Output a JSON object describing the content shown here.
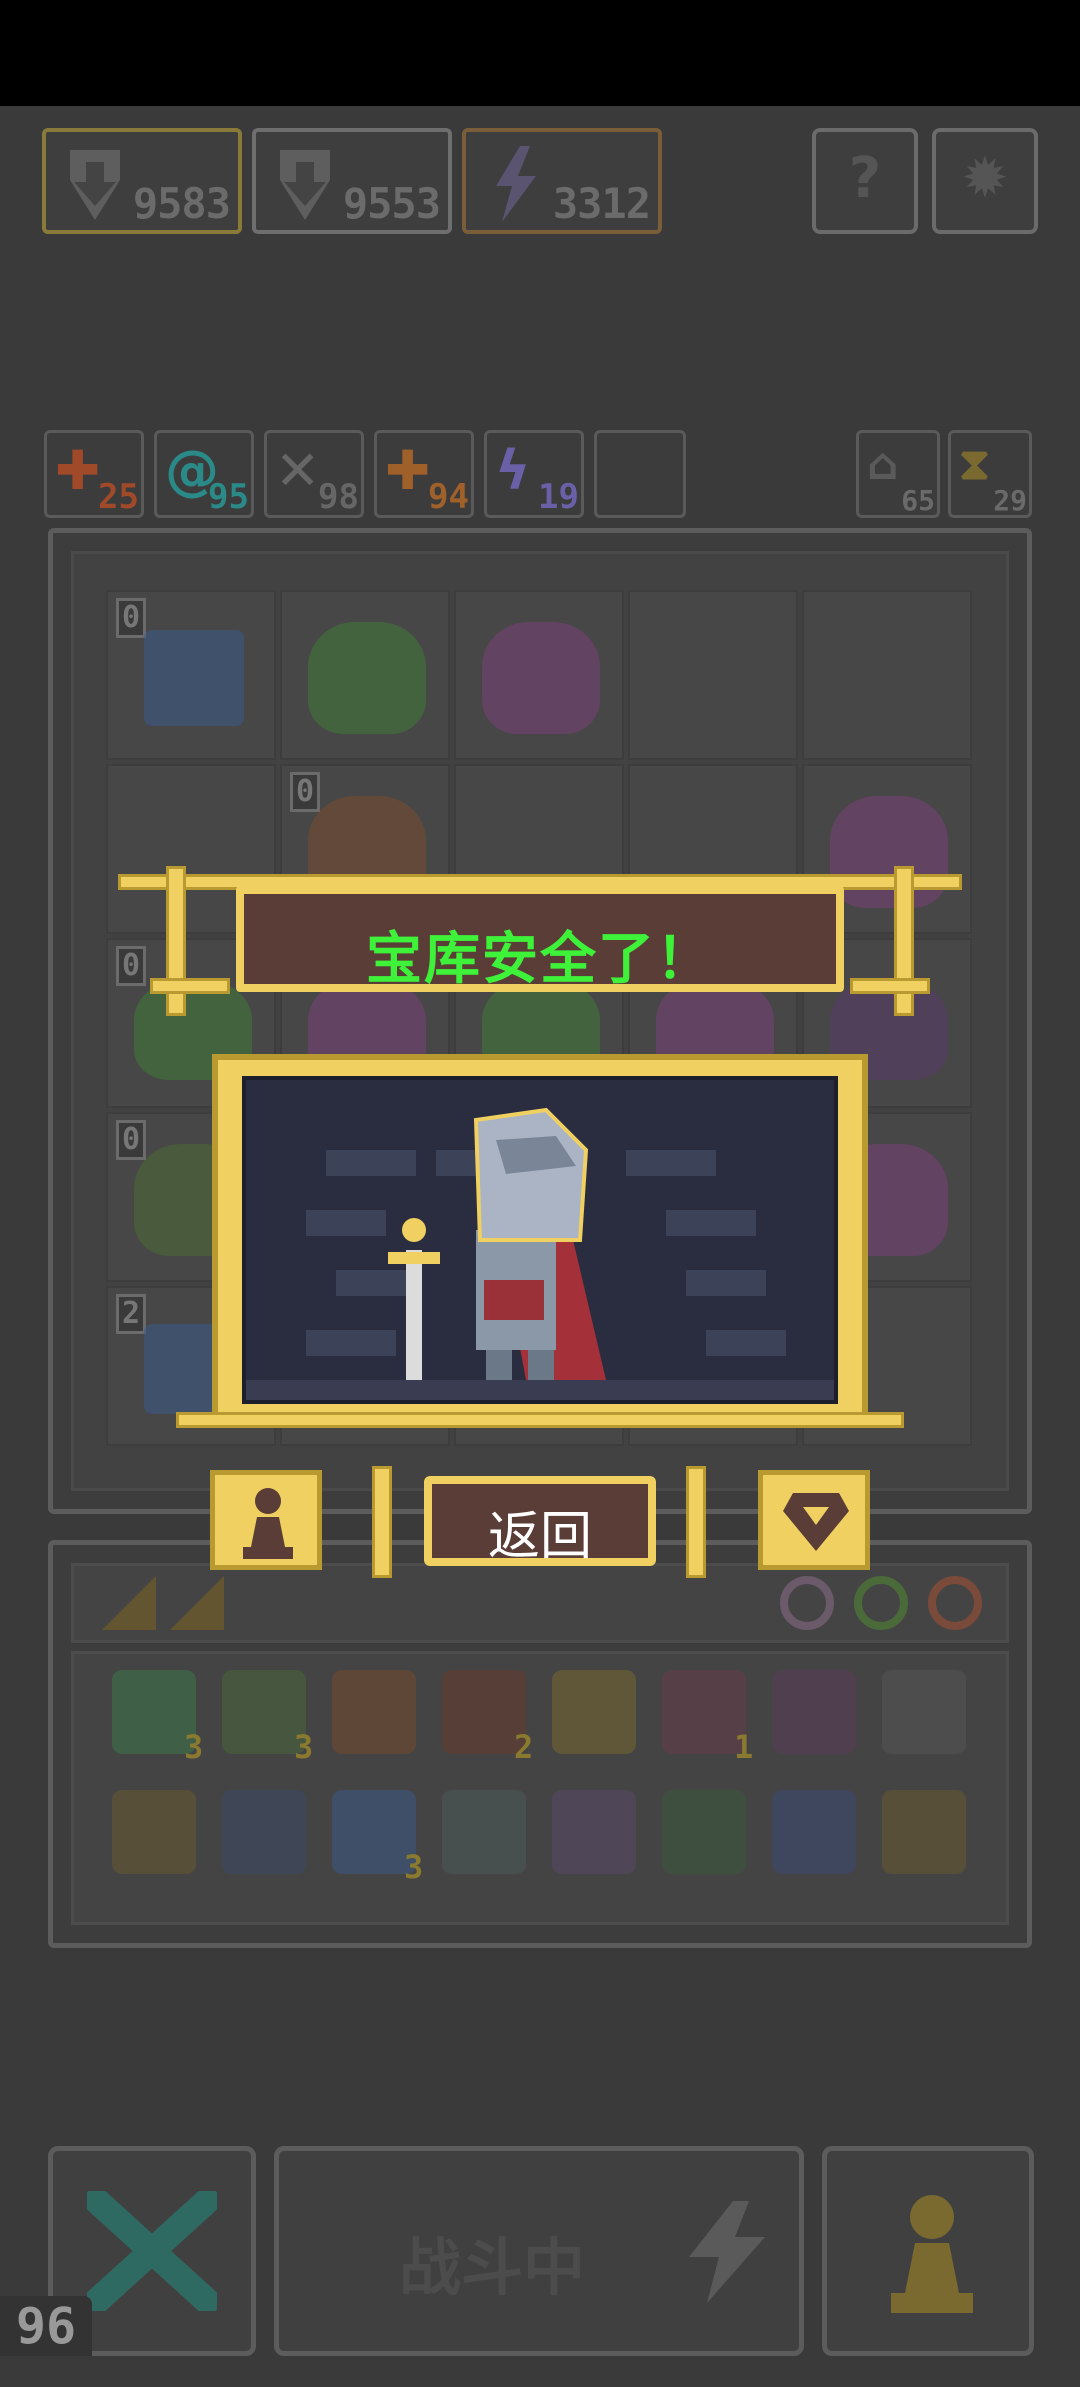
{
  "resources": [
    {
      "icon": "shield-down-icon",
      "value": "9583"
    },
    {
      "icon": "shield-down-icon",
      "value": "9553"
    },
    {
      "icon": "lightning-icon",
      "value": "3312"
    }
  ],
  "top_buttons": [
    {
      "icon": "help-icon",
      "glyph": "?"
    },
    {
      "icon": "settings-icon",
      "glyph": "✹"
    }
  ],
  "stat_chips": [
    {
      "icon": "attack-plus-icon",
      "glyph": "✚",
      "value": "25",
      "color": "#a04a2a"
    },
    {
      "icon": "vortex-icon",
      "glyph": "@",
      "value": "95",
      "color": "#2a8a88"
    },
    {
      "icon": "wing-icon",
      "glyph": "✕",
      "value": "98",
      "color": "#666666"
    },
    {
      "icon": "attack-plus-icon",
      "glyph": "✚",
      "value": "94",
      "color": "#a0602a"
    },
    {
      "icon": "lightning-icon",
      "glyph": "ϟ",
      "value": "19",
      "color": "#6a60a8"
    }
  ],
  "side_chips": [
    {
      "icon": "exit-icon",
      "value": "65"
    },
    {
      "icon": "hourglass-icon",
      "value": "29"
    }
  ],
  "board_levels": [
    "0",
    "0",
    "0",
    "0",
    "2"
  ],
  "dialog": {
    "title": "宝库安全了！",
    "back_label": "返回"
  },
  "item_counts": [
    "3",
    "3",
    "2",
    "1",
    "3"
  ],
  "bottom": {
    "battle_label": "战斗中",
    "level": "96"
  },
  "colors": {
    "gold": "#f0d060",
    "banner_bg": "#5a3d36",
    "title_green": "#3ef23a"
  }
}
